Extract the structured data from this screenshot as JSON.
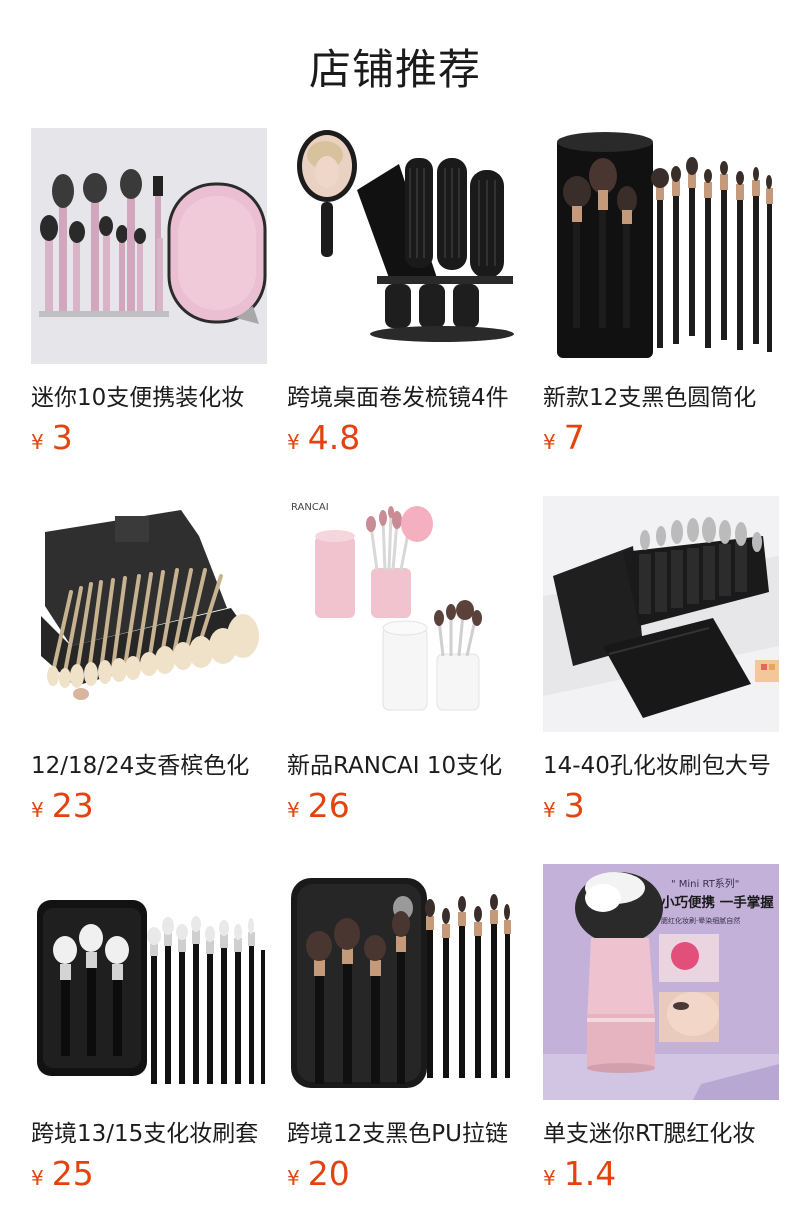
{
  "page": {
    "title": "店铺推荐"
  },
  "currency_symbol": "¥",
  "products": [
    {
      "name": "迷你10支便携装化妆",
      "price": "3",
      "image": "pink-brush-set-with-case-icon"
    },
    {
      "name": "跨境桌面卷发梳镜4件",
      "price": "4.8",
      "image": "comb-mirror-stand-icon"
    },
    {
      "name": "新款12支黑色圆筒化",
      "price": "7",
      "image": "black-brush-set-cylinder-icon"
    },
    {
      "name": "12/18/24支香槟色化",
      "price": "23",
      "image": "champagne-brush-set-icon"
    },
    {
      "name": "新品RANCAI 10支化",
      "price": "26",
      "image": "rancai-brush-cups-icon",
      "image_text": "RANCAI"
    },
    {
      "name": "14-40孔化妆刷包大号",
      "price": "3",
      "image": "brush-bag-icon"
    },
    {
      "name": "跨境13/15支化妆刷套",
      "price": "25",
      "image": "black-brush-set-case-icon"
    },
    {
      "name": "跨境12支黑色PU拉链",
      "price": "20",
      "image": "black-pu-zip-bag-icon"
    },
    {
      "name": "单支迷你RT腮红化妆",
      "price": "1.4",
      "image": "single-mini-brush-icon",
      "image_text": [
        "\" Mini RT系列\"",
        "小巧便携 一手掌握",
        "腮红化妆刷·晕染细腻自然"
      ]
    }
  ]
}
